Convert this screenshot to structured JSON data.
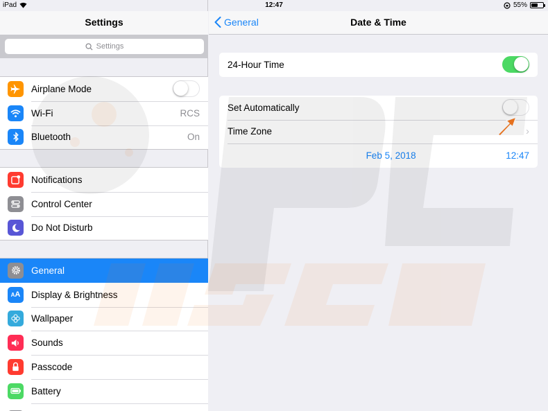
{
  "status_bar": {
    "device": "iPad",
    "time": "12:47",
    "battery": "55%",
    "battery_level": 0.55
  },
  "left_pane": {
    "title": "Settings",
    "search_placeholder": "Settings",
    "groups": [
      [
        {
          "label": "Airplane Mode",
          "icon": "airplane-icon",
          "color": "#ff9500",
          "control": "toggle-off"
        },
        {
          "label": "Wi-Fi",
          "icon": "wifi-icon",
          "color": "#1a86f8",
          "value": "RCS"
        },
        {
          "label": "Bluetooth",
          "icon": "bluetooth-icon",
          "color": "#1a86f8",
          "value": "On"
        }
      ],
      [
        {
          "label": "Notifications",
          "icon": "notifications-icon",
          "color": "#ff3b30"
        },
        {
          "label": "Control Center",
          "icon": "control-center-icon",
          "color": "#8e8e93"
        },
        {
          "label": "Do Not Disturb",
          "icon": "moon-icon",
          "color": "#5856d6"
        }
      ],
      [
        {
          "label": "General",
          "icon": "gear-icon",
          "color": "#8e8e93",
          "selected": true
        },
        {
          "label": "Display & Brightness",
          "icon": "display-icon",
          "color": "#1a86f8"
        },
        {
          "label": "Wallpaper",
          "icon": "wallpaper-icon",
          "color": "#34aadc"
        },
        {
          "label": "Sounds",
          "icon": "speaker-icon",
          "color": "#ff2d55"
        },
        {
          "label": "Passcode",
          "icon": "lock-icon",
          "color": "#ff3b30"
        },
        {
          "label": "Battery",
          "icon": "battery-icon",
          "color": "#4cd964"
        }
      ]
    ]
  },
  "right_pane": {
    "back_label": "General",
    "title": "Date & Time",
    "hour24": {
      "label": "24-Hour Time",
      "on": true
    },
    "set_automatically": {
      "label": "Set Automatically",
      "on": false
    },
    "time_zone": {
      "label": "Time Zone"
    },
    "date": "Feb 5, 2018",
    "time": "12:47"
  },
  "colors": {
    "accent": "#1a86f8",
    "toggle_on": "#4cd964",
    "arrow": "#f47920"
  }
}
